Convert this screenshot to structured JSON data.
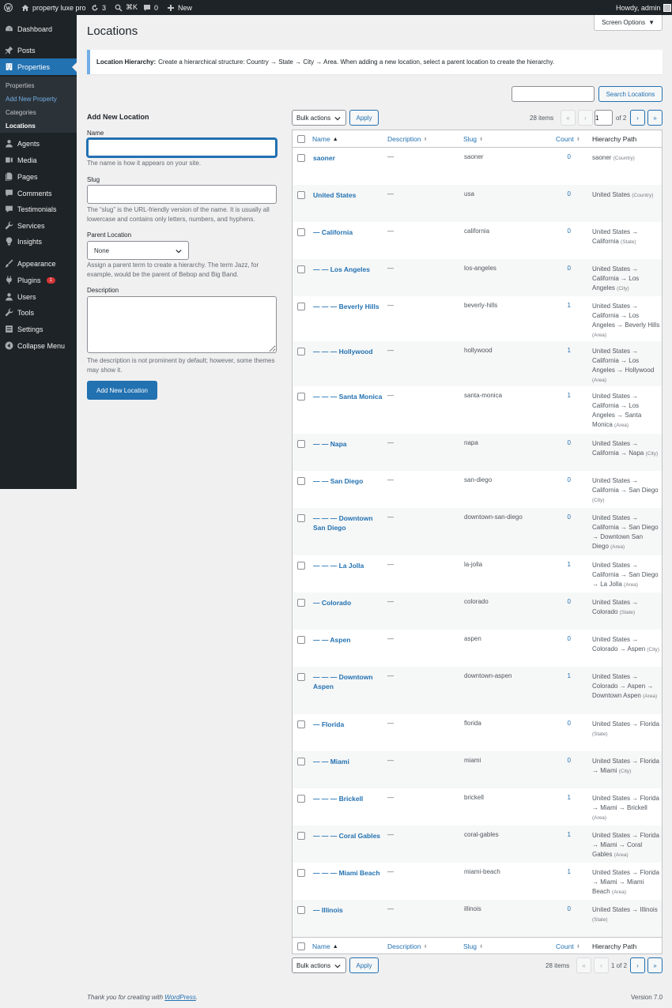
{
  "admin_bar": {
    "site_name": "property luxe pro",
    "updates_count": "3",
    "search_shortcut": "⌘K",
    "comments_count": "0",
    "new_label": "New",
    "howdy": "Howdy, admin"
  },
  "menu": {
    "dashboard": "Dashboard",
    "posts": "Posts",
    "properties": "Properties",
    "sub_properties": "Properties",
    "sub_add_new": "Add New Property",
    "sub_categories": "Categories",
    "sub_locations": "Locations",
    "agents": "Agents",
    "media": "Media",
    "pages": "Pages",
    "comments": "Comments",
    "testimonials": "Testimonials",
    "services": "Services",
    "insights": "Insights",
    "appearance": "Appearance",
    "plugins": "Plugins",
    "plugins_badge": "1",
    "users": "Users",
    "tools": "Tools",
    "settings": "Settings",
    "collapse": "Collapse Menu"
  },
  "page": {
    "title": "Locations",
    "screen_options": "Screen Options"
  },
  "notice": {
    "label": "Location Hierarchy:",
    "text": "Create a hierarchical structure: Country → State → City → Area. When adding a new location, select a parent location to create the hierarchy."
  },
  "search": {
    "value": "",
    "button": "Search Locations"
  },
  "form": {
    "title": "Add New Location",
    "name_label": "Name",
    "name_value": "",
    "name_desc": "The name is how it appears on your site.",
    "slug_label": "Slug",
    "slug_value": "",
    "slug_desc": "The “slug” is the URL-friendly version of the name. It is usually all lowercase and contains only letters, numbers, and hyphens.",
    "parent_label": "Parent Location",
    "parent_value": "None",
    "parent_desc": "Assign a parent term to create a hierarchy. The term Jazz, for example, would be the parent of Bebop and Big Band.",
    "desc_label": "Description",
    "desc_value": "",
    "desc_desc": "The description is not prominent by default; however, some themes may show it.",
    "submit": "Add New Location"
  },
  "table_nav": {
    "bulk_actions": "Bulk actions",
    "apply": "Apply",
    "items": "28 items",
    "first": "«",
    "prev": "‹",
    "current_page": "1",
    "of_pages": "of 2",
    "bottom_pages": "1 of 2",
    "next": "›",
    "last": "»"
  },
  "columns": {
    "name": "Name",
    "description": "Description",
    "slug": "Slug",
    "count": "Count",
    "hierarchy": "Hierarchy Path"
  },
  "rows": [
    {
      "name": "saoner",
      "desc": "—",
      "slug": "saoner",
      "count": "0",
      "path": "saoner",
      "level": "(Country)"
    },
    {
      "name": "United States",
      "desc": "—",
      "slug": "usa",
      "count": "0",
      "path": "United States",
      "level": "(Country)"
    },
    {
      "name": "— California",
      "desc": "—",
      "slug": "california",
      "count": "0",
      "path": "United States → California",
      "level": "(State)"
    },
    {
      "name": "— — Los Angeles",
      "desc": "—",
      "slug": "los-angeles",
      "count": "0",
      "path": "United States → California → Los Angeles",
      "level": "(City)"
    },
    {
      "name": "— — — Beverly Hills",
      "desc": "—",
      "slug": "beverly-hills",
      "count": "1",
      "path": "United States → California → Los Angeles → Beverly Hills",
      "level": "(Area)"
    },
    {
      "name": "— — — Hollywood",
      "desc": "—",
      "slug": "hollywood",
      "count": "1",
      "path": "United States → California → Los Angeles → Hollywood",
      "level": "(Area)"
    },
    {
      "name": "— — — Santa Monica",
      "desc": "—",
      "slug": "santa-monica",
      "count": "1",
      "path": "United States → California → Los Angeles → Santa Monica",
      "level": "(Area)"
    },
    {
      "name": "— — Napa",
      "desc": "—",
      "slug": "napa",
      "count": "0",
      "path": "United States → California → Napa",
      "level": "(City)"
    },
    {
      "name": "— — San Diego",
      "desc": "—",
      "slug": "san-diego",
      "count": "0",
      "path": "United States → California → San Diego",
      "level": "(City)"
    },
    {
      "name": "— — — Downtown San Diego",
      "desc": "—",
      "slug": "downtown-san-diego",
      "count": "0",
      "path": "United States → California → San Diego → Downtown San Diego",
      "level": "(Area)"
    },
    {
      "name": "— — — La Jolla",
      "desc": "—",
      "slug": "la-jolla",
      "count": "1",
      "path": "United States → California → San Diego → La Jolla",
      "level": "(Area)"
    },
    {
      "name": "— Colorado",
      "desc": "—",
      "slug": "colorado",
      "count": "0",
      "path": "United States → Colorado",
      "level": "(State)"
    },
    {
      "name": "— — Aspen",
      "desc": "—",
      "slug": "aspen",
      "count": "0",
      "path": "United States → Colorado → Aspen",
      "level": "(City)"
    },
    {
      "name": "— — — Downtown Aspen",
      "desc": "—",
      "slug": "downtown-aspen",
      "count": "1",
      "path": "United States → Colorado → Aspen → Downtown Aspen",
      "level": "(Area)"
    },
    {
      "name": "— Florida",
      "desc": "—",
      "slug": "florida",
      "count": "0",
      "path": "United States → Florida",
      "level": "(State)"
    },
    {
      "name": "— — Miami",
      "desc": "—",
      "slug": "miami",
      "count": "0",
      "path": "United States → Florida → Miami",
      "level": "(City)"
    },
    {
      "name": "— — — Brickell",
      "desc": "—",
      "slug": "brickell",
      "count": "1",
      "path": "United States → Florida → Miami → Brickell",
      "level": "(Area)"
    },
    {
      "name": "— — — Coral Gables",
      "desc": "—",
      "slug": "coral-gables",
      "count": "1",
      "path": "United States → Florida → Miami → Coral Gables",
      "level": "(Area)"
    },
    {
      "name": "— — — Miami Beach",
      "desc": "—",
      "slug": "miami-beach",
      "count": "1",
      "path": "United States → Florida → Miami → Miami Beach",
      "level": "(Area)"
    },
    {
      "name": "— Illinois",
      "desc": "—",
      "slug": "illinois",
      "count": "0",
      "path": "United States → Illinois",
      "level": "(State)"
    }
  ],
  "footer": {
    "thanks_prefix": "Thank you for creating with",
    "thanks_link": "WordPress",
    "thanks_suffix": ".",
    "version": "Version 7.0"
  }
}
